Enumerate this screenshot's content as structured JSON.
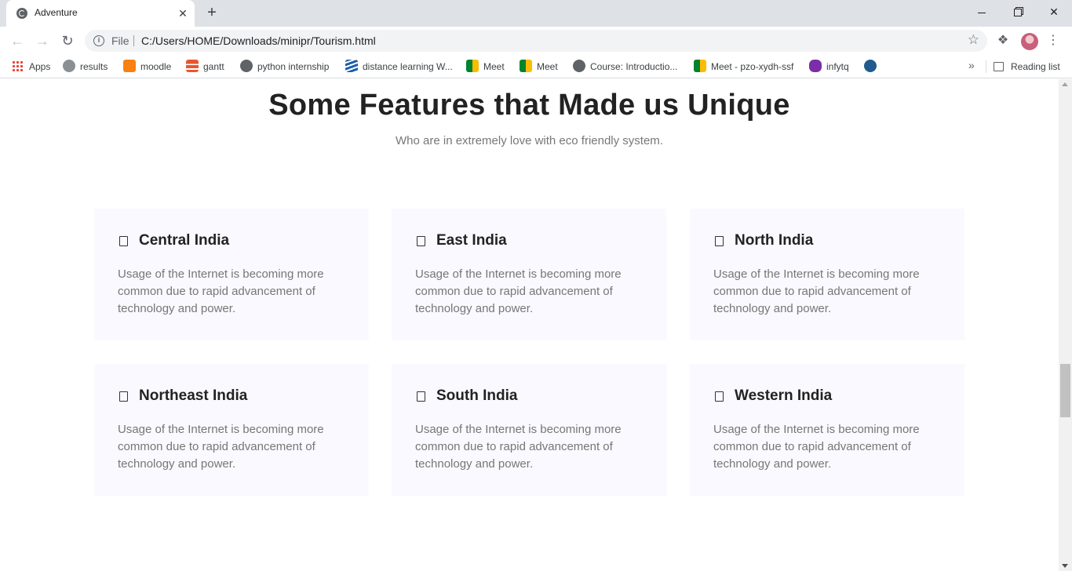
{
  "browser": {
    "tab_title": "Adventure",
    "new_tab_symbol": "+",
    "close_symbol": "✕",
    "scheme": "File",
    "url": "C:/Users/HOME/Downloads/minipr/Tourism.html",
    "icons": [
      "globe-icon",
      "back-icon",
      "forward-icon",
      "reload-icon",
      "info-icon",
      "star-icon",
      "extensions-icon",
      "profile-avatar",
      "menu-icon"
    ]
  },
  "bookmarks": {
    "items": [
      {
        "label": "Apps"
      },
      {
        "label": "results"
      },
      {
        "label": "moodle"
      },
      {
        "label": "gantt"
      },
      {
        "label": "python internship"
      },
      {
        "label": "distance learning W..."
      },
      {
        "label": "Meet"
      },
      {
        "label": "Meet"
      },
      {
        "label": "Course: Introductio..."
      },
      {
        "label": "Meet - pzo-xydh-ssf"
      },
      {
        "label": "infytq"
      },
      {
        "label": ""
      }
    ],
    "overflow_symbol": "»",
    "reading_list": "Reading list"
  },
  "page": {
    "heading": "Some Features that Made us Unique",
    "subheading": "Who are in extremely love with eco friendly system.",
    "features": [
      {
        "title": "Central India",
        "text": "Usage of the Internet is becoming more common due to rapid advancement of technology and power."
      },
      {
        "title": "East India",
        "text": "Usage of the Internet is becoming more common due to rapid advancement of technology and power."
      },
      {
        "title": "North India",
        "text": "Usage of the Internet is becoming more common due to rapid advancement of technology and power."
      },
      {
        "title": "Northeast India",
        "text": "Usage of the Internet is becoming more common due to rapid advancement of technology and power."
      },
      {
        "title": "South India",
        "text": "Usage of the Internet is becoming more common due to rapid advancement of technology and power."
      },
      {
        "title": "Western India",
        "text": "Usage of the Internet is becoming more common due to rapid advancement of technology and power."
      }
    ]
  },
  "colors": {
    "card_background": "#f9f9ff",
    "heading": "#222222",
    "body_text": "#777777",
    "tabstrip": "#dee1e6"
  }
}
